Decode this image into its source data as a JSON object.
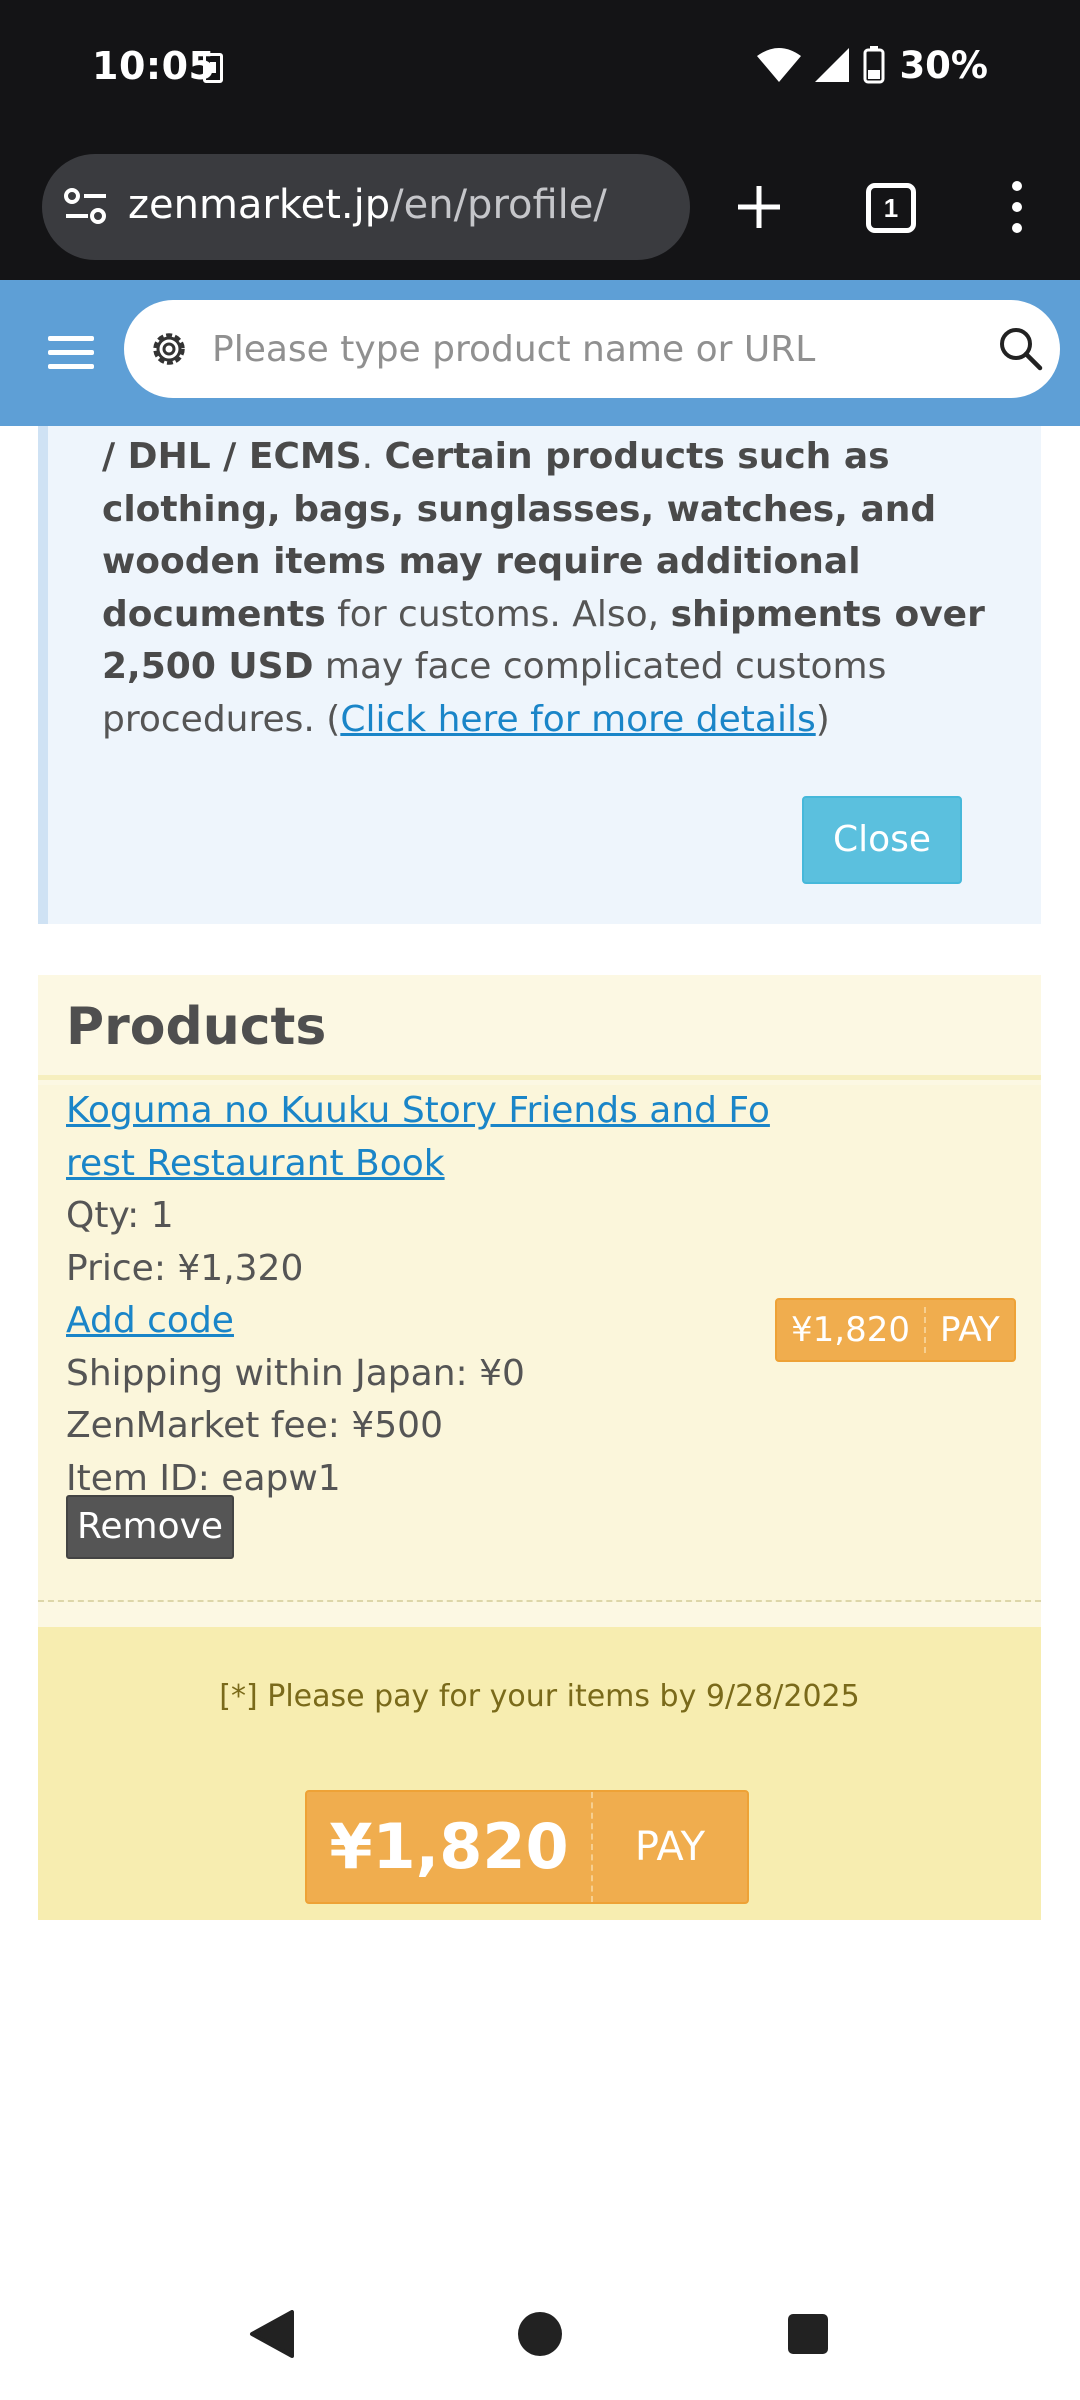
{
  "status_bar": {
    "time": "10:05",
    "battery": "30%"
  },
  "browser": {
    "url_domain": "zenmarket.jp",
    "url_path": "/en/profile/",
    "tab_count": "1"
  },
  "header": {
    "search_placeholder": "Please type product name or URL",
    "accent_color": "#5e9fd6"
  },
  "notice": {
    "seg1": "/ DHL / ECMS",
    "seg2": ". ",
    "seg3": "Certain products such as clothing, bags, sunglasses, watches, and wooden items may require additional documents",
    "seg4": " for customs. Also, ",
    "seg5": "shipments over 2,500 USD",
    "seg6": " may face complicated customs procedures. (",
    "link": "Click here for more details",
    "seg7": ")",
    "close_label": "Close"
  },
  "products": {
    "title": "Products",
    "item": {
      "name_line1": "Koguma no Kuuku Story Friends and Fo",
      "name_line2": "rest Restaurant Book",
      "qty": "Qty: 1",
      "price": "Price: ¥1,320",
      "add_code": "Add code",
      "shipping": "Shipping within Japan: ¥0",
      "fee": "ZenMarket fee: ¥500",
      "item_id": "Item ID: eapw1",
      "remove_label": "Remove",
      "pay_amount": "¥1,820",
      "pay_label": "PAY"
    },
    "due_note": "[*] Please pay for your items by 9/28/2025",
    "total_amount": "¥1,820",
    "total_pay_label": "PAY"
  }
}
